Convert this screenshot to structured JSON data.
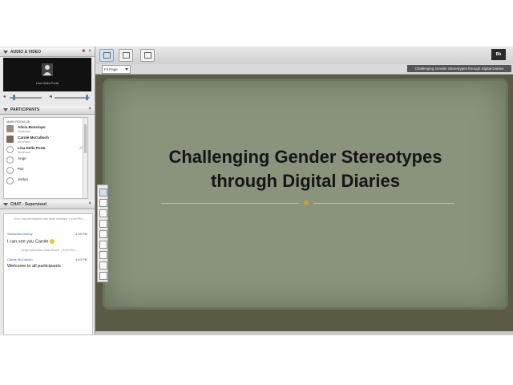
{
  "audio_video": {
    "title": "AUDIO & VIDEO",
    "presenter_name": "Lisa Della Porta"
  },
  "participants": {
    "title": "PARTICIPANTS",
    "room_label": "MAIN ROOM (3)",
    "list": [
      {
        "name": "Alicia Bonciopo",
        "role": "Moderator",
        "avatar": "photo"
      },
      {
        "name": "Carole McCulloch",
        "role": "Moderator",
        "avatar": "photo"
      },
      {
        "name": "Lisa Della Porta",
        "role": "Moderator",
        "avatar": "generic"
      },
      {
        "name": "Ange",
        "role": "",
        "avatar": "generic"
      },
      {
        "name": "Pat",
        "role": "",
        "avatar": "generic"
      },
      {
        "name": "Jaclyn",
        "role": "",
        "avatar": "generic"
      }
    ]
  },
  "chat": {
    "title": "CHAT - Supervised",
    "system1": "- Your chat permission has been enabled. ( 4:48 PM ) -",
    "msg1_name": "Samantha McKay",
    "msg1_time": "4:38 PM",
    "msg1_text": "I can see you Carole",
    "system2": "- Ange joined the Main Room. ( 5:09 PM ) -",
    "msg2_name": "Carole McCulloch",
    "msg2_time": "4:43 PM",
    "msg2_text": "Welcome to all participants"
  },
  "toolbar": {
    "fit_page": "Fit Page",
    "logo_text": "Bb"
  },
  "document": {
    "name": "Challenging Gender Stereotypes through Digital Diaries"
  },
  "slide": {
    "title_line1": "Challenging Gender Stereotypes",
    "title_line2": "through Digital Diaries"
  },
  "colors": {
    "slide_bg": "#8a947d",
    "stage_bg": "#5b5b45",
    "accent": "#4a80c0"
  }
}
